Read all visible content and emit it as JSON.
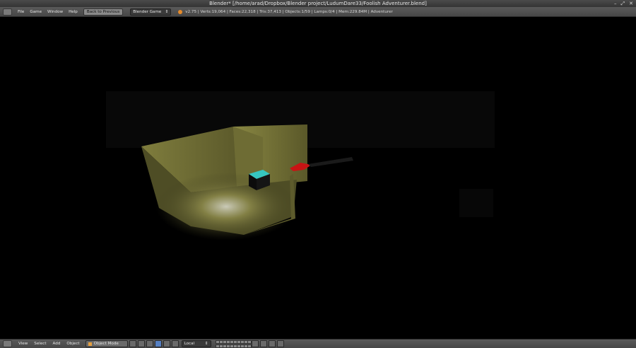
{
  "window": {
    "title": "Blender* [/home/arad/Dropbox/Blender project/LudumDare33/Foolish Adventurer.blend]"
  },
  "topbar": {
    "menus": [
      "File",
      "Game",
      "Window",
      "Help"
    ],
    "back_button": "Back to Previous",
    "engine": "Blender Game",
    "stats": "v2.75 | Verts:19,064 | Faces:22,318 | Tris:37,413 | Objects:1/59 | Lamps:0/4 | Mem:229.84M | Adventurer"
  },
  "bottombar": {
    "menus": [
      "View",
      "Select",
      "Add",
      "Object"
    ],
    "mode": "Object Mode",
    "orientation": "Local"
  },
  "colors": {
    "lit_wall": "#7d7b3c",
    "floor": "#6b6a36",
    "cube_top": "#36c6c0",
    "red_object": "#c81414"
  }
}
